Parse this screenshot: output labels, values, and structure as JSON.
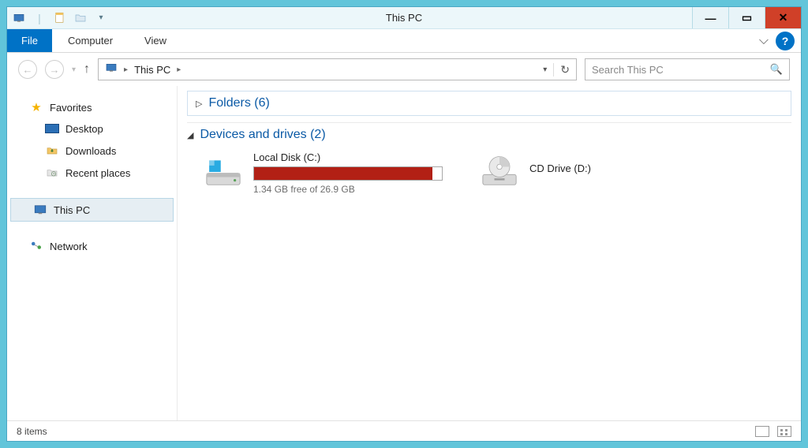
{
  "window": {
    "title": "This PC"
  },
  "ribbon": {
    "file": "File",
    "tabs": [
      "Computer",
      "View"
    ]
  },
  "nav": {
    "breadcrumb": "This PC",
    "search_placeholder": "Search This PC"
  },
  "sidebar": {
    "favorites": {
      "label": "Favorites",
      "items": [
        "Desktop",
        "Downloads",
        "Recent places"
      ]
    },
    "thispc": {
      "label": "This PC"
    },
    "network": {
      "label": "Network"
    }
  },
  "sections": {
    "folders": {
      "label": "Folders",
      "count": 6,
      "expanded": false
    },
    "drives": {
      "label": "Devices and drives",
      "count": 2,
      "items": [
        {
          "name": "Local Disk (C:)",
          "free_text": "1.34 GB free of 26.9 GB",
          "used_pct": 95
        },
        {
          "name": "CD Drive (D:)"
        }
      ]
    }
  },
  "status": {
    "items_text": "8 items"
  }
}
